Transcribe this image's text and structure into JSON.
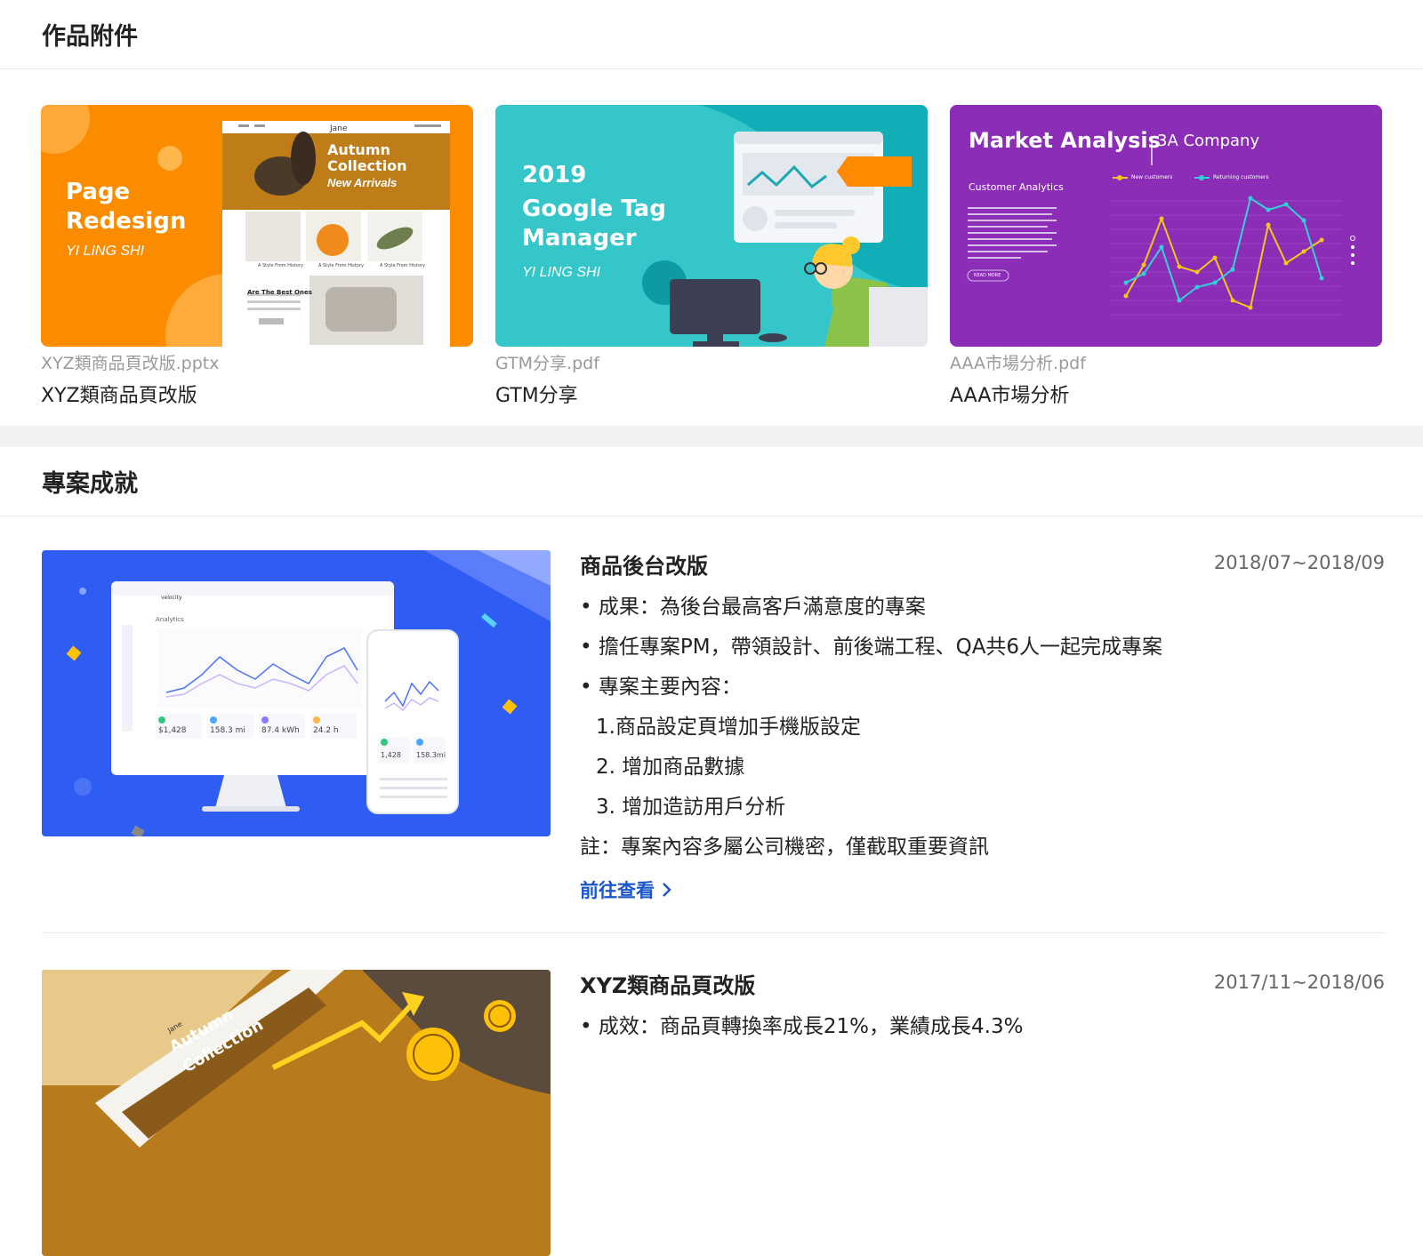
{
  "attachments": {
    "heading": "作品附件",
    "items": [
      {
        "file": "XYZ類商品頁改版.pptx",
        "title": "XYZ類商品頁改版",
        "thumb": {
          "line1": "Page",
          "line2": "Redesign",
          "author": "YI LING SHI",
          "brand": "Jane",
          "hero1": "Autumn",
          "hero2": "Collection",
          "hero3": "New Arrivals",
          "section": "Are The Best Ones",
          "caption": "A Style From History"
        }
      },
      {
        "file": "GTM分享.pdf",
        "title": "GTM分享",
        "thumb": {
          "line1": "2019",
          "line2": "Google Tag",
          "line3": "Manager",
          "author": "YI LING SHI"
        }
      },
      {
        "file": "AAA市場分析.pdf",
        "title": "AAA市場分析",
        "thumb": {
          "title": "Market Analysis",
          "company": "3A Company",
          "sub": "Customer Analytics",
          "legend1": "New customers",
          "legend2": "Returning customers",
          "button": "READ MORE"
        }
      }
    ]
  },
  "achievements": {
    "heading": "專案成就",
    "projects": [
      {
        "title": "商品後台改版",
        "date": "2018/07~2018/09",
        "bullets": [
          "• 成果：為後台最高客戶滿意度的專案",
          "• 擔任專案PM，帶領設計、前後端工程、QA共6人一起完成專案",
          "• 專案主要內容："
        ],
        "subitems": [
          "1.商品設定頁增加手機版設定",
          "2. 增加商品數據",
          "3. 增加造訪用戶分析"
        ],
        "note": "註：專案內容多屬公司機密，僅截取重要資訊",
        "link": "前往查看",
        "mock": {
          "app": "velocity",
          "screen": "Analytics",
          "stat1": "$1,428",
          "stat2": "158.3 mi",
          "stat3": "87.4 kWh",
          "stat4": "24.2 h",
          "pstat1": "1,428",
          "pstat2": "158.3mi"
        }
      },
      {
        "title": "XYZ類商品頁改版",
        "date": "2017/11~2018/06",
        "bullets": [
          "• 成效：商品頁轉換率成長21%，業績成長4.3%"
        ],
        "mock": {
          "brand": "Jane",
          "hero": "Autumn",
          "hero2": "Collection"
        }
      }
    ]
  },
  "colors": {
    "link": "#1a56c9",
    "orange": "#fb8c00",
    "teal": "#1fbfc5",
    "purple": "#8e2bb5",
    "blue": "#2f5cf2"
  }
}
